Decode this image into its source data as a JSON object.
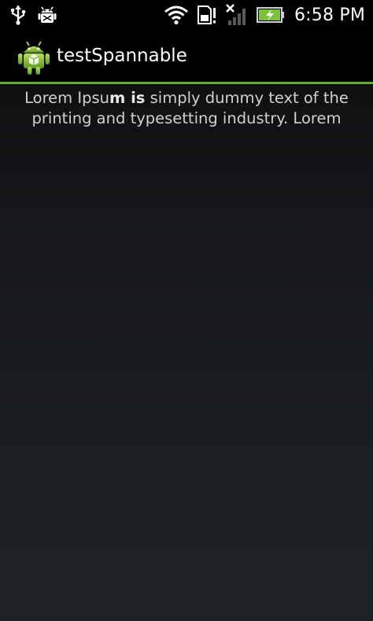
{
  "status_bar": {
    "time": "6:58 PM",
    "icons": [
      "usb-icon",
      "android-debug-icon",
      "wifi-icon",
      "sd-card-alert-icon",
      "no-signal-icon",
      "battery-charging-icon"
    ]
  },
  "app": {
    "title": "testSpannable",
    "icon": "android-app-icon",
    "accent_color": "#6aaa3a"
  },
  "content": {
    "line1_part1": "Lorem Ipsu",
    "line1_bold": "m is",
    "line1_part2": " simply dummy text of the",
    "line2": "printing and typesetting industry. Lorem"
  }
}
